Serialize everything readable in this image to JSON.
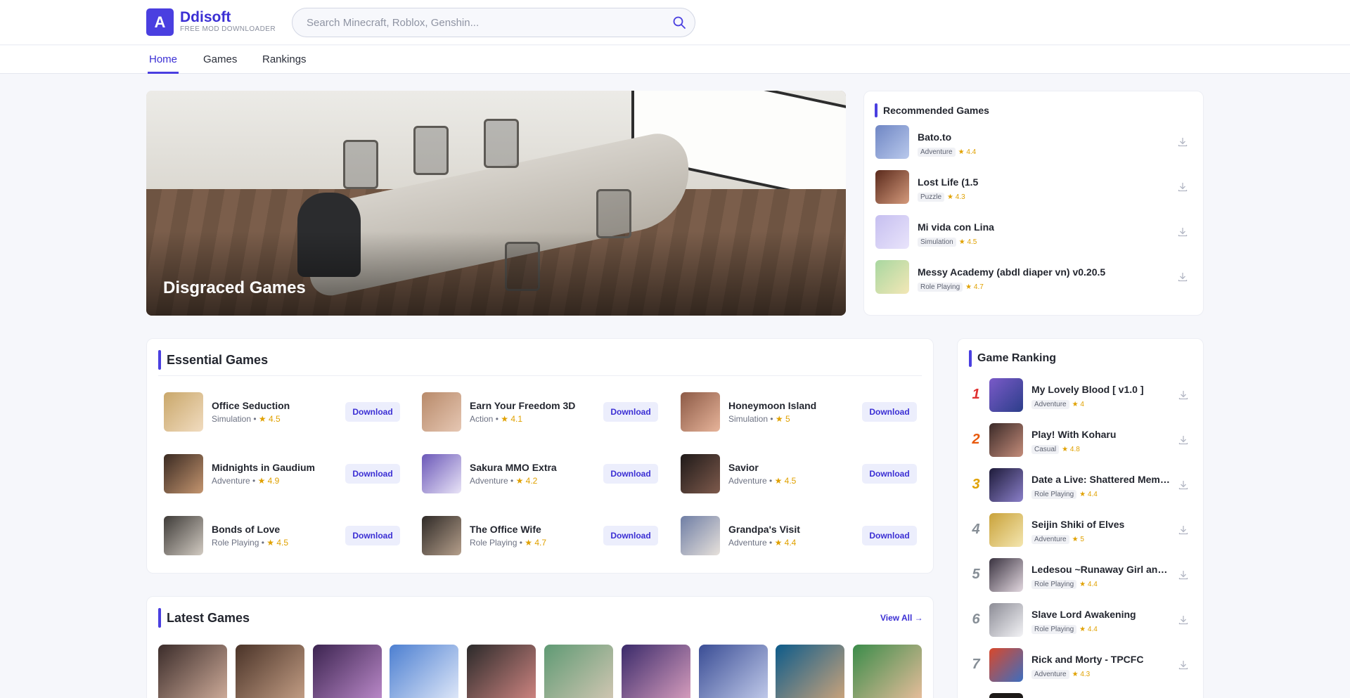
{
  "brand": {
    "logo_letter": "A",
    "name": "Ddisoft",
    "tagline": "FREE MOD DOWNLOADER"
  },
  "search": {
    "placeholder": "Search Minecraft, Roblox, Genshin...",
    "icon": "search-icon"
  },
  "nav": {
    "items": [
      {
        "label": "Home",
        "active": true
      },
      {
        "label": "Games"
      },
      {
        "label": "Rankings"
      }
    ]
  },
  "hero": {
    "title": "Disgraced Games"
  },
  "recommended": {
    "title": "Recommended Games",
    "items": [
      {
        "name": "Bato.to",
        "category": "Adventure",
        "rating": "★ 4.4"
      },
      {
        "name": "Lost Life (1.5",
        "category": "Puzzle",
        "rating": "★ 4.3"
      },
      {
        "name": "Mi vida con Lina",
        "category": "Simulation",
        "rating": "★ 4.5"
      },
      {
        "name": "Messy Academy (abdl diaper vn) v0.20.5",
        "category": "Role Playing",
        "rating": "★ 4.7"
      }
    ]
  },
  "essential": {
    "title": "Essential Games",
    "download_label": "Download",
    "items": [
      {
        "name": "Office Seduction",
        "category": "Simulation",
        "rating": "★ 4.5"
      },
      {
        "name": "Earn Your Freedom 3D",
        "category": "Action",
        "rating": "★ 4.1"
      },
      {
        "name": "Honeymoon Island",
        "category": "Simulation",
        "rating": "★ 5"
      },
      {
        "name": "Midnights in Gaudium",
        "category": "Adventure",
        "rating": "★ 4.9"
      },
      {
        "name": "Sakura MMO Extra",
        "category": "Adventure",
        "rating": "★ 4.2"
      },
      {
        "name": "Savior",
        "category": "Adventure",
        "rating": "★ 4.5"
      },
      {
        "name": "Bonds of Love",
        "category": "Role Playing",
        "rating": "★ 4.5"
      },
      {
        "name": "The Office Wife",
        "category": "Role Playing",
        "rating": "★ 4.7"
      },
      {
        "name": "Grandpa's Visit",
        "category": "Adventure",
        "rating": "★ 4.4"
      }
    ]
  },
  "latest": {
    "title": "Latest Games",
    "view_all": "View All →"
  },
  "ranking": {
    "title": "Game Ranking",
    "items": [
      {
        "rank": "1",
        "name": "My Lovely Blood [ v1.0 ]",
        "category": "Adventure",
        "rating": "★ 4",
        "color": "#e03131"
      },
      {
        "rank": "2",
        "name": "Play! With Koharu",
        "category": "Casual",
        "rating": "★ 4.8",
        "color": "#e8590c"
      },
      {
        "rank": "3",
        "name": "Date a Live: Shattered Memo...",
        "category": "Role Playing",
        "rating": "★ 4.4",
        "color": "#e0a100"
      },
      {
        "rank": "4",
        "name": "Seijin Shiki of Elves",
        "category": "Adventure",
        "rating": "★ 5",
        "color": "#868e96"
      },
      {
        "rank": "5",
        "name": "Ledesou ~Runaway Girl and ...",
        "category": "Role Playing",
        "rating": "★ 4.4",
        "color": "#868e96"
      },
      {
        "rank": "6",
        "name": "Slave Lord Awakening",
        "category": "Role Playing",
        "rating": "★ 4.4",
        "color": "#868e96"
      },
      {
        "rank": "7",
        "name": "Rick and Morty - TPCFC",
        "category": "Adventure",
        "rating": "★ 4.3",
        "color": "#868e96"
      }
    ]
  }
}
